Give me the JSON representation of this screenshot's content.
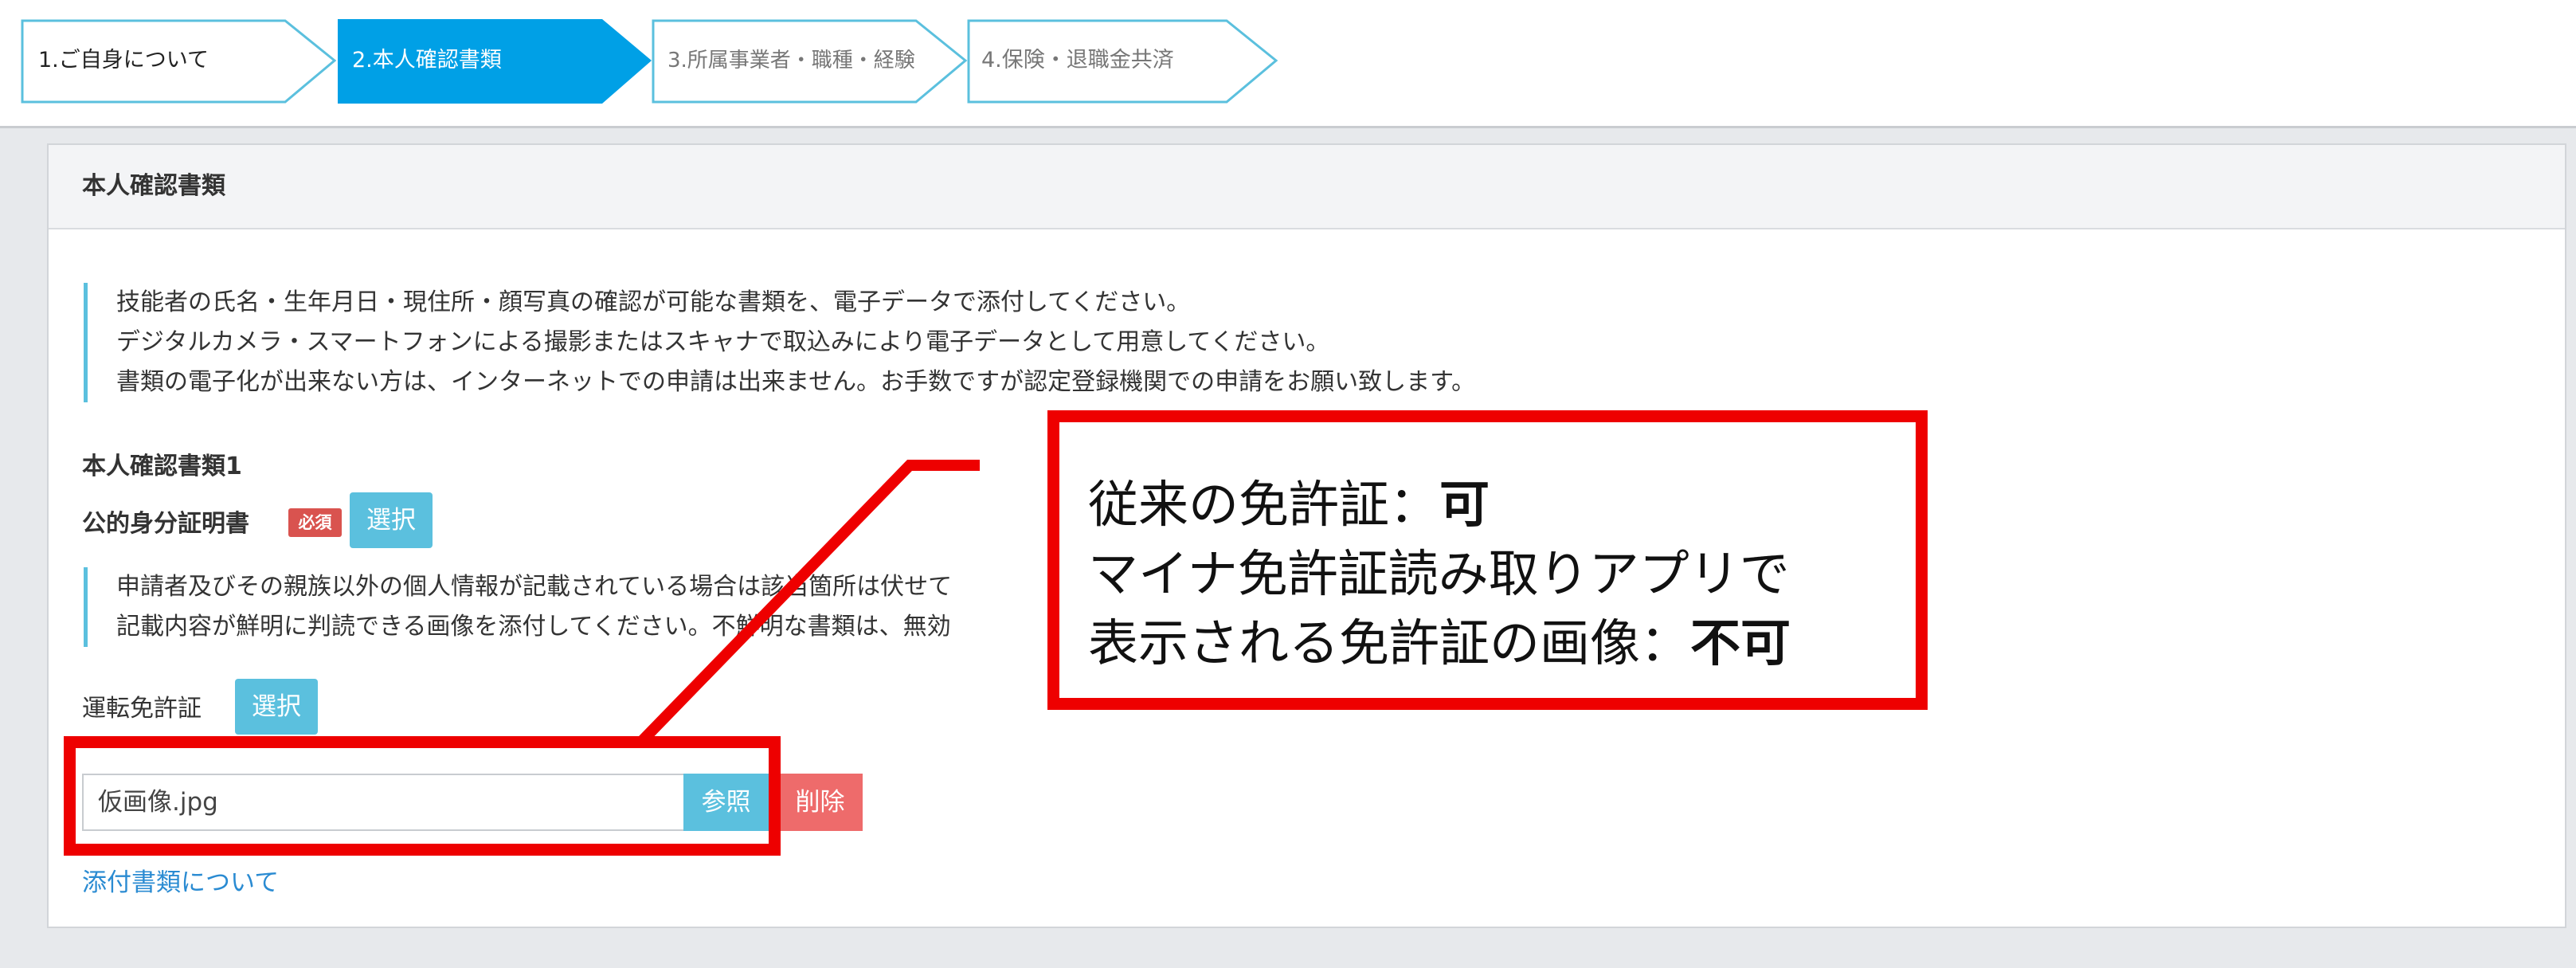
{
  "steps": [
    {
      "label": "1.ご自身について",
      "state": "done"
    },
    {
      "label": "2.本人確認書類",
      "state": "active"
    },
    {
      "label": "3.所属事業者・職種・経験",
      "state": "todo"
    },
    {
      "label": "4.保険・退職金共済",
      "state": "todo"
    }
  ],
  "panel": {
    "title": "本人確認書類",
    "intro_lines": [
      "技能者の氏名・生年月日・現住所・顔写真の確認が可能な書類を、電子データで添付してください。",
      "デジタルカメラ・スマートフォンによる撮影またはスキャナで取込みにより電子データとして用意してください。",
      "書類の電子化が出来ない方は、インターネットでの申請は出来ません。お手数ですが認定登録機関での申請をお願い致します。"
    ],
    "doc1_heading": "本人確認書類1",
    "public_id_label": "公的身分証明書",
    "required_badge": "必須",
    "select_button": "選択",
    "privacy_lines": [
      "申請者及びその親族以外の個人情報が記載されている場合は該当箇所は伏せて",
      "記載内容が鮮明に判読できる画像を添付してください。不鮮明な書類は、無効"
    ],
    "license_label": "運転免許証",
    "license_select_button": "選択",
    "file_value": "仮画像.jpg",
    "browse_button": "参照",
    "delete_button": "削除",
    "attach_link": "添付書類について"
  },
  "callout": {
    "line1_prefix": "従来の免許証：",
    "line1_value": "可",
    "line2": "マイナ免許証読み取りアプリで",
    "line3_prefix": "表示される免許証の画像：",
    "line3_value": "不可"
  },
  "colors": {
    "active_step": "#00a0e6",
    "step_border": "#5bc0de",
    "accent_button": "#5bc0de",
    "delete_button": "#ee6b6b",
    "required_badge": "#d9534f",
    "annotation_red": "#ee0000",
    "link": "#2a8bd2"
  }
}
